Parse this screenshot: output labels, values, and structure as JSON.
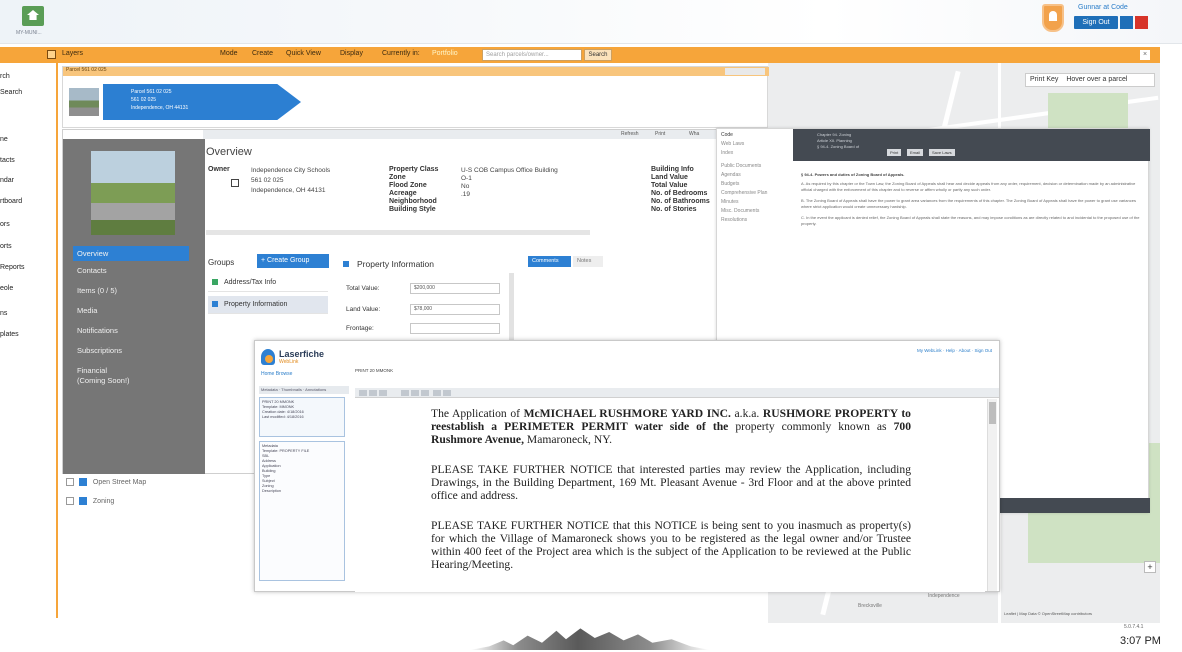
{
  "header": {
    "logo_caption": "MY-MUNI...",
    "user_name": "Gunnar at Code",
    "sign_out": "Sign Out"
  },
  "toolbar": {
    "items": [
      "Layers",
      "Mode",
      "Create",
      "Quick View",
      "Display",
      "Currently in:"
    ],
    "current_mode": "Portfolio",
    "search_placeholder": "Search parcels/owner...",
    "search_button": "Search"
  },
  "left_nav": {
    "items": [
      "rch",
      "Search",
      "ne",
      "tacts",
      "ndar",
      "rtboard",
      "ors",
      "orts",
      "Reports",
      "eole",
      "ns",
      "plates"
    ]
  },
  "parcel_panel": {
    "title": "Parcel 561 02 025",
    "chevron_lines": [
      "Parcel 561 02 025",
      "561 02 025",
      "Independence, OH 44131"
    ]
  },
  "overview_toolbar": [
    "Refresh",
    "Print",
    "Wha"
  ],
  "sidebar": {
    "items": [
      "Overview",
      "Contacts",
      "Items (0 / 5)",
      "Media",
      "Notifications",
      "Subscriptions",
      "Financial",
      "(Coming Soon!)"
    ]
  },
  "overview": {
    "heading": "Overview",
    "owner_label": "Owner",
    "owner_lines": [
      "Independence City Schools",
      "561 02 025",
      "Independence, OH 44131"
    ],
    "property_labels": [
      "Property Class",
      "Zone",
      "Flood Zone",
      "Acreage",
      "Neighborhood",
      "Building Style"
    ],
    "property_values": [
      "U-S COB Campus Office Building",
      "O-1",
      "No",
      ".19"
    ],
    "building_labels": [
      "Building Info",
      "Land Value",
      "Total Value",
      "No. of Bedrooms",
      "No. of Bathrooms",
      "No. of Stories"
    ]
  },
  "groups": {
    "title": "Groups",
    "create_button": "+ Create Group",
    "rows": [
      "Address/Tax Info",
      "Property Information"
    ]
  },
  "property_information": {
    "title": "Property Information",
    "fields": [
      {
        "label": "Total Value:",
        "value": "$200,000"
      },
      {
        "label": "Land Value:",
        "value": "$78,000"
      },
      {
        "label": "Frontage:",
        "value": ""
      }
    ]
  },
  "tabs": [
    "Comments",
    "Notes"
  ],
  "layers": [
    "Open Street Map",
    "Zoning"
  ],
  "map": {
    "print_key": "Print Key",
    "hover_hint": "Hover over a parcel",
    "attribution": "Leaflet | Map Data © OpenStreetMap contributors",
    "place_labels": [
      "Brecksville",
      "Independence"
    ]
  },
  "code_panel": {
    "nav": [
      "Code",
      "Web Laws",
      "Index",
      "Public Documents",
      "Agendas",
      "Budgets",
      "Comprehensive Plan",
      "Minutes",
      "Misc. Documents",
      "Resolutions"
    ],
    "header_lines": [
      "Chapter 94. Zoning",
      "Article XII. Planning",
      "§ 94-4. Zoning Board of"
    ],
    "header_buttons": [
      "Print",
      "Email",
      "Save Laws"
    ],
    "section_title": "§ 94-4. Powers and duties of Zoning Board of Appeals.",
    "paragraphs": [
      "A. As required by this chapter or the Town Law, the Zoning Board of Appeals shall hear and decide appeals from any order, requirement, decision or determination made by an administrative official charged with the enforcement of this chapter and to reverse or affirm wholly or partly any such order.",
      "B. The Zoning Board of Appeals shall have the power to grant area variances from the requirements of this chapter. The Zoning Board of Appeals shall have the power to grant use variances where strict application would create unnecessary hardship.",
      "C. In the event the applicant is denied relief, the Zoning Board of Appeals shall state the reasons, and may impose conditions as are directly related to and incidental to the proposed use of the property."
    ]
  },
  "laserfiche": {
    "brand": "Laserfiche",
    "brand_sub": "WebLink",
    "links": "Home   Browse",
    "doc_title": "PRINT 20 MMONK",
    "top_right": "My WebLink · Help · About · Sign Out",
    "nav_row": "Metadata · Thumbnails · Annotations",
    "tree_lines": [
      "PRINT 20 MMONK",
      "Template: MMONK",
      "Creation date: 4/18/2016",
      "Last modified: 4/18/2016"
    ],
    "meta_lines": [
      "Metadata",
      "Template: PROPERTY FILE",
      "SBL",
      "Address",
      "Application",
      "Building",
      "Type",
      "Subject",
      "Zoning",
      "Description"
    ],
    "paragraph1_intro": "The Application of ",
    "paragraph1_company": "McMICHAEL RUSHMORE YARD INC.",
    "paragraph1_aka": " a.k.a. ",
    "paragraph1_property": "RUSHMORE PROPERTY to reestablish a PERIMETER PERMIT water side of the",
    "paragraph1_rest": " property commonly known as ",
    "paragraph1_address": "700 Rushmore Avenue,",
    "paragraph1_city": " Mamaroneck, NY.",
    "paragraph2": "PLEASE TAKE FURTHER NOTICE that interested parties may review the Application, including Drawings, in the Building Department, 169 Mt. Pleasant Avenue - 3rd Floor and at the above printed office and address.",
    "paragraph3": "PLEASE TAKE FURTHER NOTICE that this NOTICE is being sent to you inasmuch as property(s) for which the Village of Mamaroneck shows you to be registered as the legal owner and/or Trustee within 400 feet of the Project area which is the subject of the Application to be reviewed at the Public Hearing/Meeting."
  },
  "taskbar": {
    "clock": "3:07 PM",
    "version": "5.0.7.4.1"
  },
  "colors": {
    "toolbar_orange": "#f6a53a",
    "accent_blue": "#2d80d3",
    "sidebar_gray": "#767676"
  }
}
